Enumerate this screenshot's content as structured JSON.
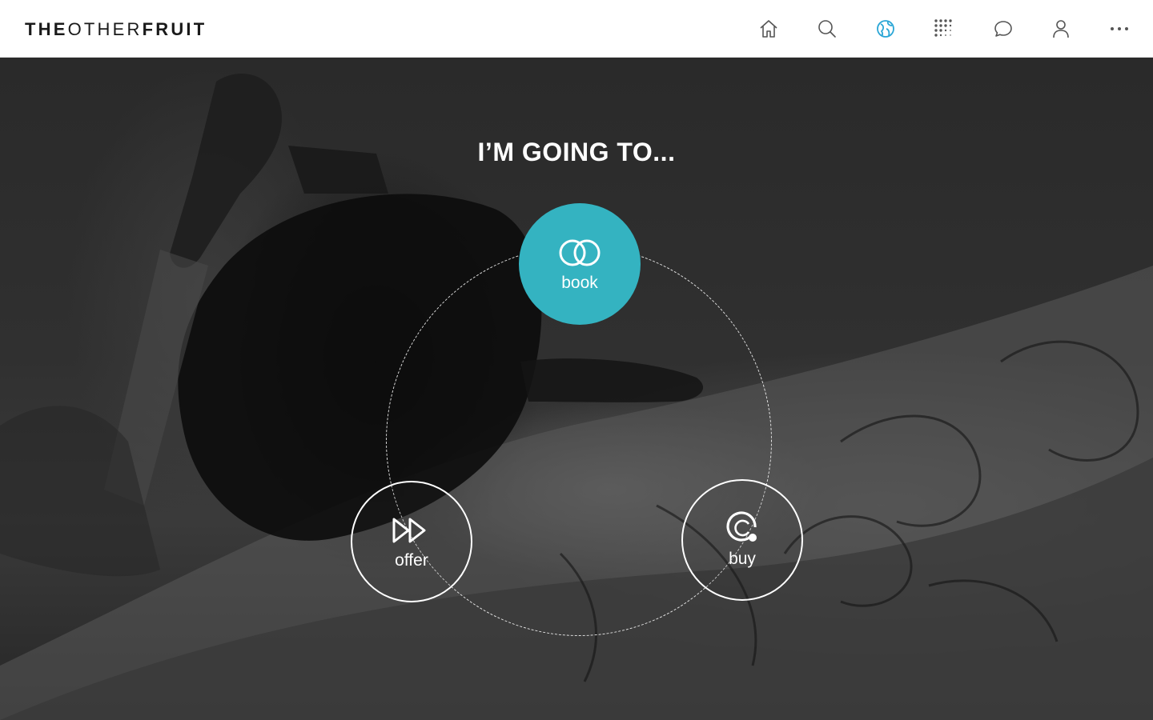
{
  "brand": {
    "part1": "THE",
    "part2": "OTHER",
    "part3": "FRUIT"
  },
  "nav": {
    "items": [
      {
        "name": "home",
        "icon": "home-icon",
        "active": false
      },
      {
        "name": "search",
        "icon": "search-icon",
        "active": false
      },
      {
        "name": "explore",
        "icon": "globe-icon",
        "active": true
      },
      {
        "name": "apps",
        "icon": "dot-grid-icon",
        "active": false
      },
      {
        "name": "messages",
        "icon": "chat-bubble-icon",
        "active": false
      },
      {
        "name": "profile",
        "icon": "user-icon",
        "active": false
      },
      {
        "name": "more",
        "icon": "more-icon",
        "active": false
      }
    ],
    "active_color": "#2aa6d6"
  },
  "hero": {
    "heading": "I’M GOING TO...",
    "options": {
      "book": {
        "label": "book",
        "icon": "linked-rings-icon",
        "color": "#34b3c1",
        "selected": true
      },
      "offer": {
        "label": "offer",
        "icon": "fast-forward-icon",
        "selected": false
      },
      "buy": {
        "label": "buy",
        "icon": "bag-circle-icon",
        "selected": false
      }
    }
  }
}
